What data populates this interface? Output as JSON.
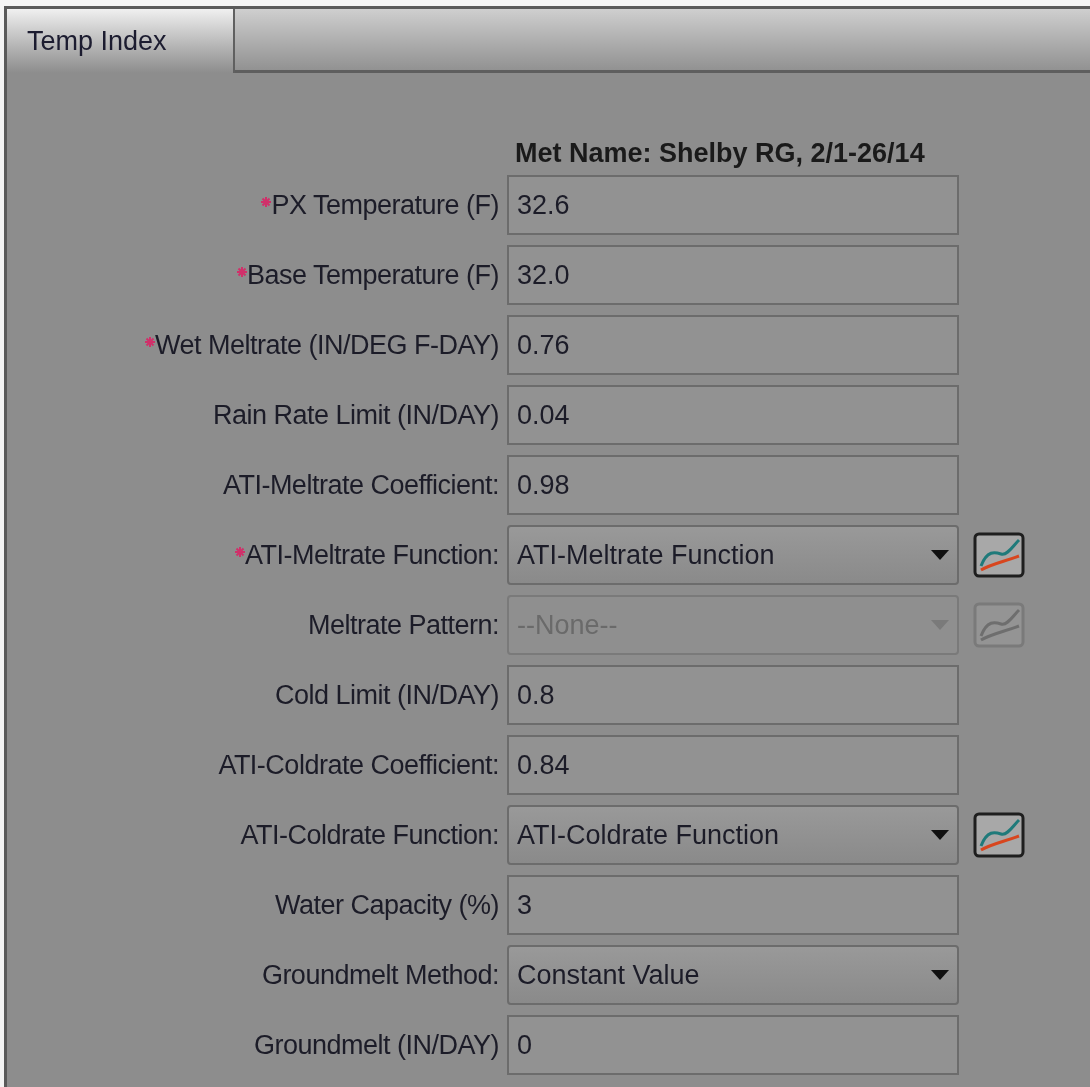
{
  "tabs": [
    {
      "label": "Temp Index",
      "selected": true
    }
  ],
  "heading": "Met Name: Shelby RG, 2/1-26/14",
  "fields": [
    {
      "kind": "text",
      "label": "PX Temperature (F)",
      "value": "32.6",
      "required": true
    },
    {
      "kind": "text",
      "label": "Base Temperature (F)",
      "value": "32.0",
      "required": true
    },
    {
      "kind": "text",
      "label": "Wet Meltrate (IN/DEG F-DAY)",
      "value": "0.76",
      "required": true
    },
    {
      "kind": "text",
      "label": "Rain Rate Limit (IN/DAY)",
      "value": "0.04",
      "required": false
    },
    {
      "kind": "text",
      "label": "ATI-Meltrate Coefficient:",
      "value": "0.98",
      "required": false
    },
    {
      "kind": "dropdown",
      "label": "ATI-Meltrate Function:",
      "value": "ATI-Meltrate Function",
      "required": true,
      "disabled": false,
      "chart_button": true
    },
    {
      "kind": "dropdown",
      "label": "Meltrate Pattern:",
      "value": "--None--",
      "required": false,
      "disabled": true,
      "chart_button": true
    },
    {
      "kind": "text",
      "label": "Cold Limit (IN/DAY)",
      "value": "0.8",
      "required": false
    },
    {
      "kind": "text",
      "label": "ATI-Coldrate Coefficient:",
      "value": "0.84",
      "required": false
    },
    {
      "kind": "dropdown",
      "label": "ATI-Coldrate Function:",
      "value": "ATI-Coldrate Function",
      "required": false,
      "disabled": false,
      "chart_button": true
    },
    {
      "kind": "text",
      "label": "Water Capacity (%)",
      "value": "3",
      "required": false
    },
    {
      "kind": "dropdown",
      "label": "Groundmelt Method:",
      "value": "Constant Value",
      "required": false,
      "disabled": false,
      "chart_button": false
    },
    {
      "kind": "text",
      "label": "Groundmelt (IN/DAY)",
      "value": "0",
      "required": false
    }
  ]
}
